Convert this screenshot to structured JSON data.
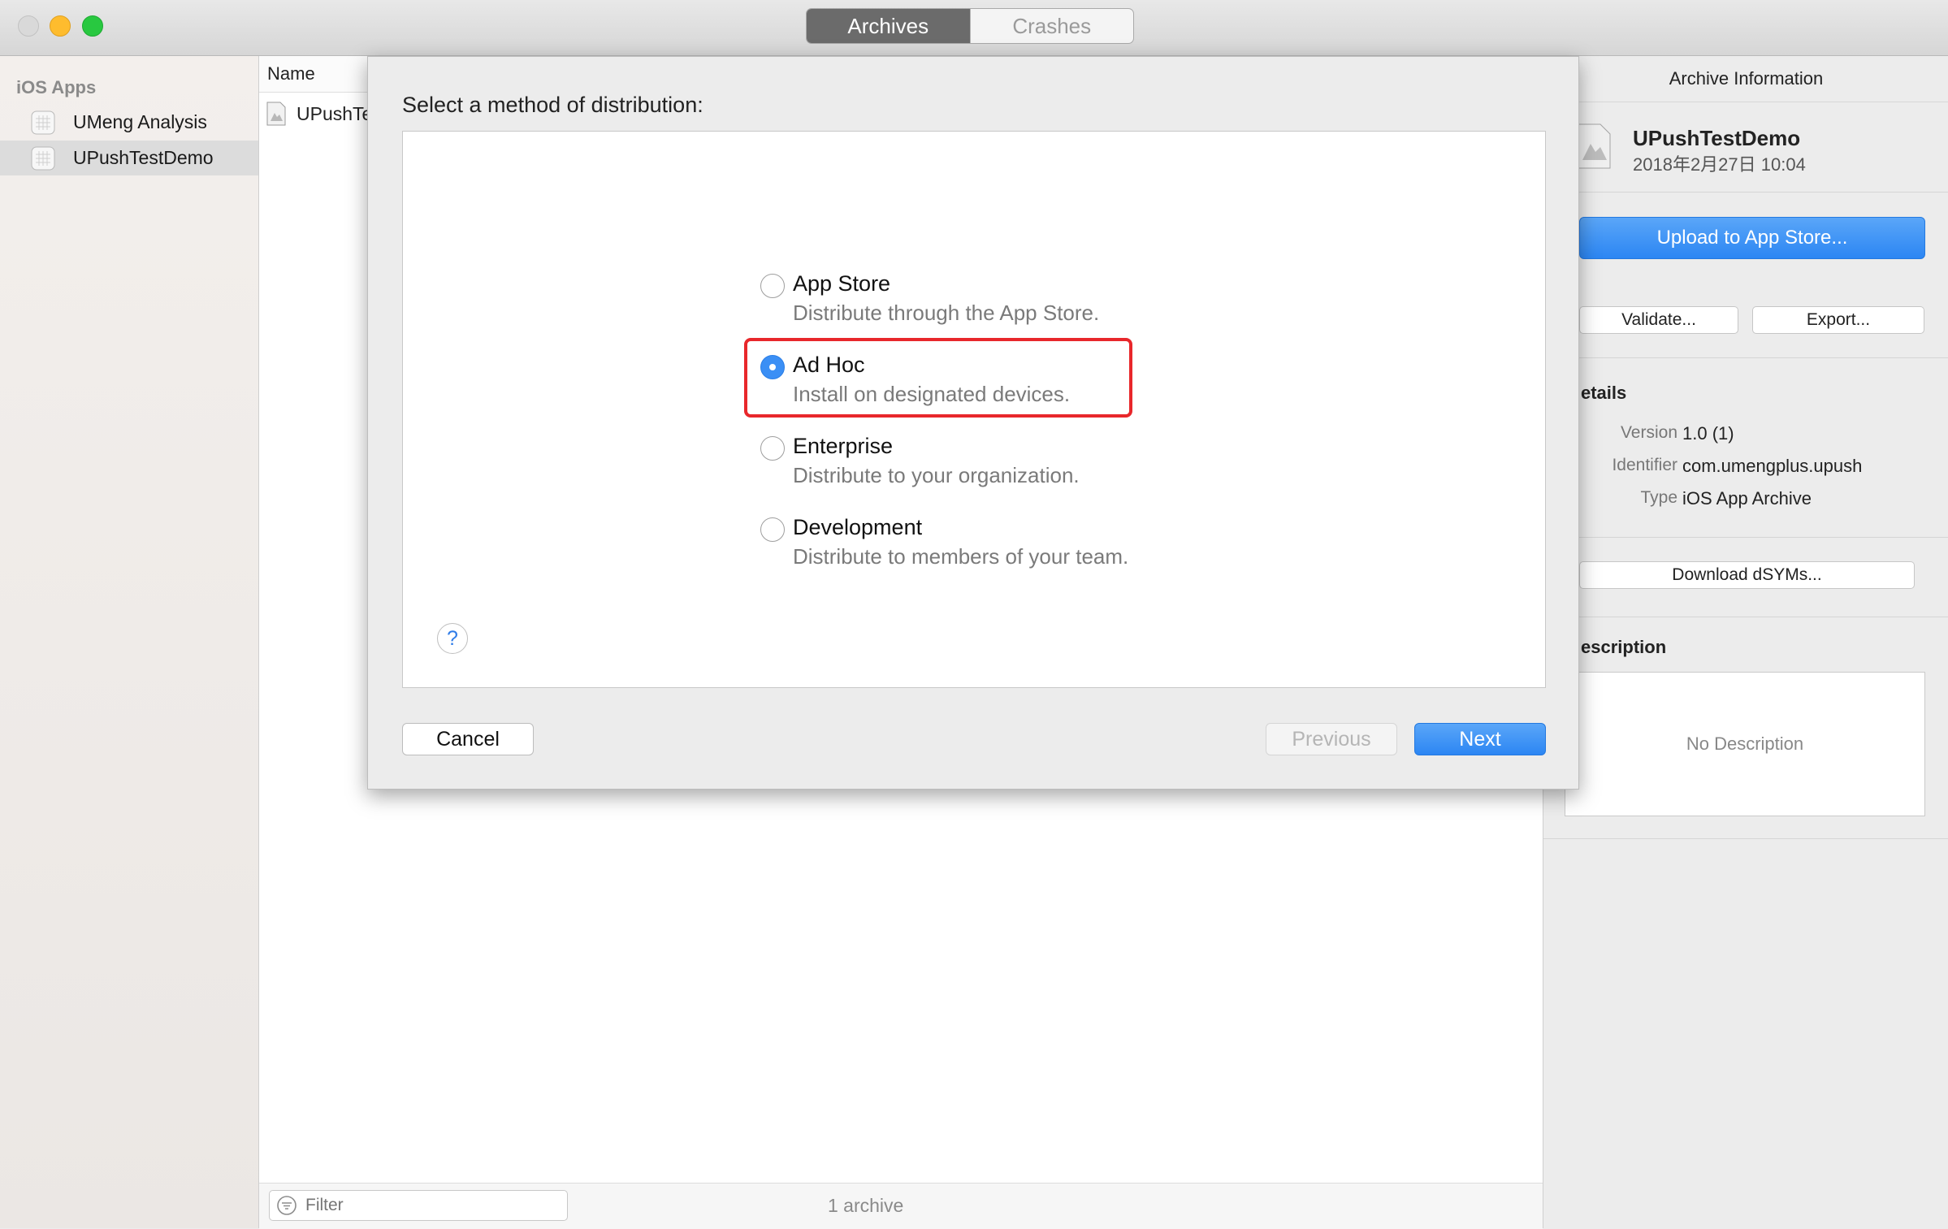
{
  "toolbar": {
    "tabs": [
      {
        "label": "Archives",
        "active": true
      },
      {
        "label": "Crashes",
        "active": false
      }
    ]
  },
  "sidebar": {
    "section_title": "iOS Apps",
    "items": [
      {
        "label": "UMeng Analysis",
        "selected": false
      },
      {
        "label": "UPushTestDemo",
        "selected": true
      }
    ]
  },
  "list": {
    "column_name": "Name",
    "rows": [
      {
        "name": "UPushTes"
      }
    ],
    "filter_placeholder": "Filter",
    "count_text": "1 archive"
  },
  "inspector": {
    "title": "Archive Information",
    "app_name": "UPushTestDemo",
    "app_date": "2018年2月27日 10:04",
    "upload_button": "Upload to App Store...",
    "validate_button": "Validate...",
    "export_button": "Export...",
    "details_label": "etails",
    "details": [
      {
        "key": "Version",
        "value": "1.0 (1)"
      },
      {
        "key": "Identifier",
        "value": "com.umengplus.upush"
      },
      {
        "key": "Type",
        "value": "iOS App Archive"
      }
    ],
    "dsyms_button": "Download dSYMs...",
    "description_label": "escription",
    "description_text": "No Description"
  },
  "sheet": {
    "title": "Select a method of distribution:",
    "options": [
      {
        "title": "App Store",
        "description": "Distribute through the App Store.",
        "selected": false
      },
      {
        "title": "Ad Hoc",
        "description": "Install on designated devices.",
        "selected": true
      },
      {
        "title": "Enterprise",
        "description": "Distribute to your organization.",
        "selected": false
      },
      {
        "title": "Development",
        "description": "Distribute to members of your team.",
        "selected": false
      }
    ],
    "help_label": "?",
    "cancel_label": "Cancel",
    "previous_label": "Previous",
    "next_label": "Next"
  },
  "colors": {
    "accent": "#3b8ff5",
    "highlight": "#e8272b"
  }
}
